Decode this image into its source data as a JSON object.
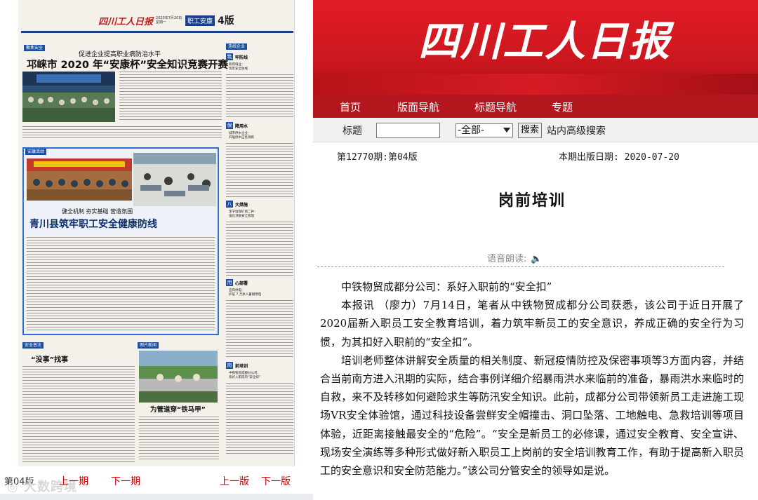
{
  "paper": {
    "logo": "四川工人日报",
    "date_line": "2020年7月20日 星期一",
    "section": "职工安康",
    "page_no": "4版",
    "tags": {
      "safety_news": "聚焦安全",
      "safety_exam": "安康活动",
      "column": "连线企业",
      "law": "安全普法",
      "photo_news": "图片新闻"
    },
    "headline1_kicker": "促进企业提高职业病防治水平",
    "headline1": "邛崃市 2020 年“安康杯”安全知识竞赛开赛",
    "headline2_kicker": "健全机制  夯实基础  营造氛围",
    "headline2": "青川县筑牢职工安全健康防线",
    "law_title": "“没事”找事",
    "photo_caption": "为管道穿“铁马甲”",
    "side_column": [
      {
        "char": "筑",
        "title": "牢防线",
        "sub": "新得煤业：\n筑牢安全防线"
      },
      {
        "char": "保",
        "title": "障用水",
        "sub": "城市供水企业：\n开展供水应急演练"
      },
      {
        "char": "八",
        "title": "大措施",
        "sub": "李子垭煤矿南二井：\n强化顶板安全管理"
      },
      {
        "char": "用",
        "title": "心部署",
        "sub": "宜宾供电：\n护航 7 万余人暑期用电"
      },
      {
        "char": "岗",
        "title": "前培训",
        "sub": "中铁物贸成都分公司：\n系好入职前的“安全扣”"
      }
    ]
  },
  "pager": {
    "page_label": "第04版",
    "prev_page": "上一期",
    "next_page": "下一期",
    "prev_edition": "上一版",
    "next_edition": "下一版",
    "watermark": "大数跨境"
  },
  "site": {
    "brand": "四川工人日报",
    "nav": [
      "首页",
      "版面导航",
      "标题导航",
      "专题"
    ],
    "search": {
      "label": "标题",
      "scope": "-全部-",
      "button": "搜索",
      "advanced": "站内高级搜索"
    }
  },
  "article": {
    "issue": "第12770期:第04版",
    "pubdate": "本期出版日期: 2020-07-20",
    "title": "岗前培训",
    "tts": "语音朗读:",
    "subtitle": "中铁物贸成都分公司：系好入职前的“安全扣”",
    "p1": "本报讯 （廖力）7月14日，笔者从中铁物贸成都分公司获悉，该公司于近日开展了2020届新入职员工安全教育培训，着力筑牢新员工的安全意识，养成正确的安全行为习惯，为其扣好入职前的“安全扣”。",
    "p2": "培训老师整体讲解安全质量的相关制度、新冠疫情防控及保密事项等3方面内容，并结合当前南方进入汛期的实际，结合事例详细介绍暴雨洪水来临前的准备，暴雨洪水来临时的自救，来不及转移如何避险求生等防汛安全知识。此前，成都分公司带领新员工走进施工现场VR安全体验馆，通过科技设备尝鲜安全帽撞击、洞口坠落、工地触电、急救培训等项目体验，近距离接触最安全的“危险”。“安全是新员工的必修课，通过安全教育、安全宣讲、现场安全演练等多种形式做好新入职员工上岗前的安全培训教育工作，有助于提高新入职员工的安全意识和安全防范能力。”该公司分管安全的领导如是说。"
  }
}
